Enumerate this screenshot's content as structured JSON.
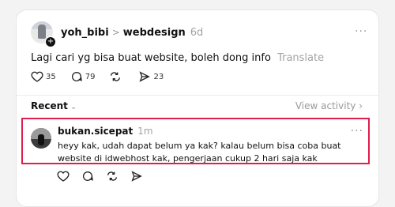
{
  "post": {
    "username": "yoh_bibi",
    "separator": ">",
    "topic": "webdesign",
    "time": "6d",
    "more": "···",
    "text": "Lagi cari yg bisa buat website, boleh dong info",
    "translate": "Translate",
    "likes": "35",
    "comments": "79",
    "shares": "23",
    "plus": "+"
  },
  "recent_bar": {
    "label": "Recent",
    "chevron": "⌄",
    "view_activity": "View activity ›"
  },
  "reply": {
    "username": "bukan.sicepat",
    "time": "1m",
    "more": "···",
    "text": "heyy kak, udah dapat belum ya kak? kalau belum bisa coba buat website di idwebhost kak, pengerjaan cukup 2 hari saja kak"
  },
  "colors": {
    "highlight_border": "#e01e4c",
    "muted_text": "#a3a3a3"
  }
}
